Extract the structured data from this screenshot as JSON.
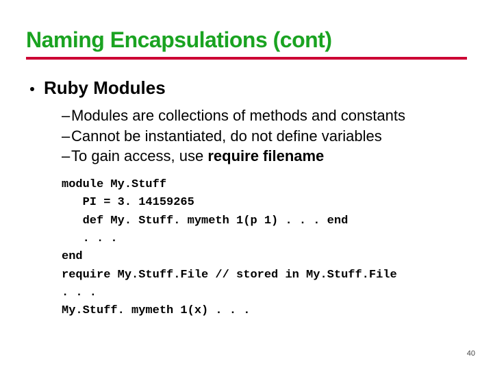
{
  "colors": {
    "title": "#1aa321",
    "rule": "#cc0033"
  },
  "title": "Naming Encapsulations (cont)",
  "bullet": "Ruby Modules",
  "subs": [
    "Modules are collections of methods and constants",
    "Cannot be instantiated, do not define variables"
  ],
  "sub3_prefix": "To gain access, use ",
  "sub3_kw": "require filename",
  "code": "module My.Stuff\n   PI = 3. 14159265\n   def My. Stuff. mymeth 1(p 1) . . . end\n   . . .\nend\nrequire My.Stuff.File // stored in My.Stuff.File\n. . .\nMy.Stuff. mymeth 1(x) . . .",
  "page": "40"
}
